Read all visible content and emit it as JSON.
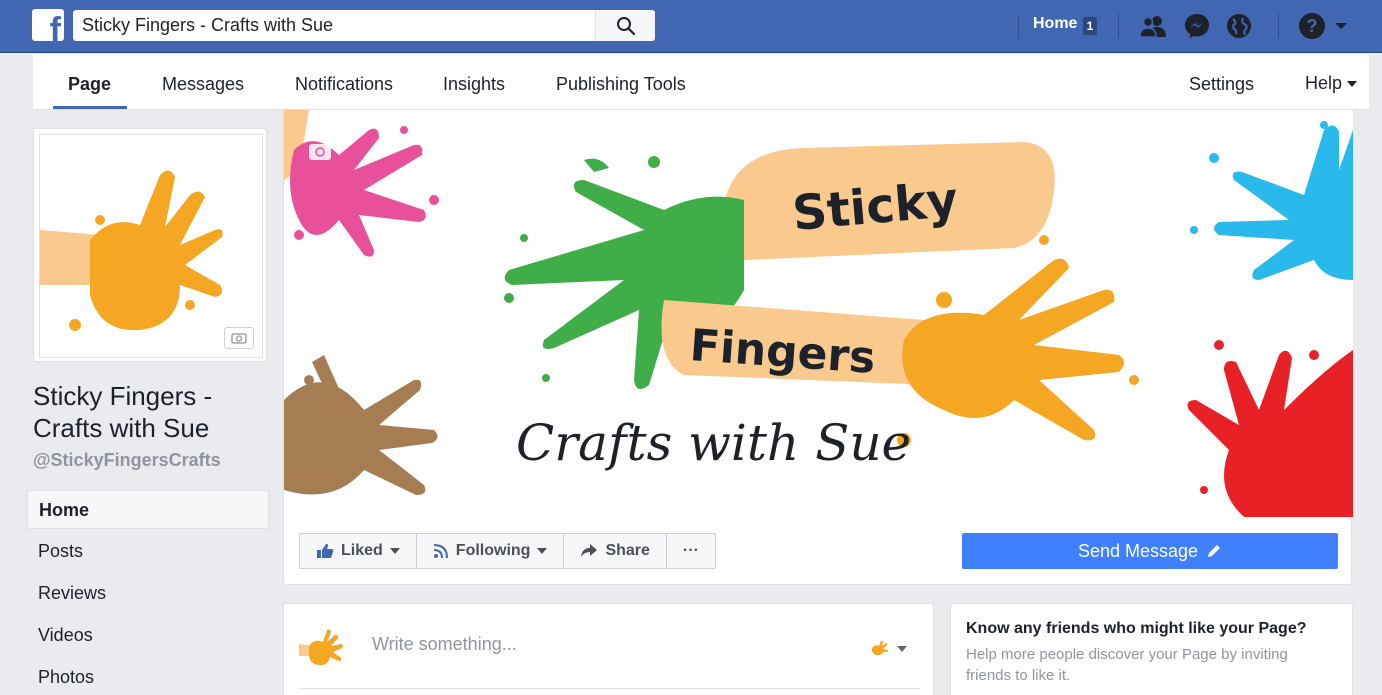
{
  "topbar": {
    "logo": "f",
    "search_value": "Sticky Fingers - Crafts with Sue",
    "home_label": "Home",
    "home_badge": "1",
    "icons": [
      "friends-icon",
      "messenger-icon",
      "globe-icon",
      "help-icon",
      "dropdown-caret-icon"
    ]
  },
  "pagenav": {
    "tabs": [
      {
        "label": "Page",
        "active": true
      },
      {
        "label": "Messages"
      },
      {
        "label": "Notifications"
      },
      {
        "label": "Insights"
      },
      {
        "label": "Publishing Tools"
      }
    ],
    "settings_label": "Settings",
    "help_label": "Help"
  },
  "sidebar": {
    "page_name": "Sticky Fingers - Crafts with Sue",
    "handle": "@StickyFingersCrafts",
    "items": [
      {
        "label": "Home",
        "active": true
      },
      {
        "label": "Posts"
      },
      {
        "label": "Reviews"
      },
      {
        "label": "Videos"
      },
      {
        "label": "Photos"
      }
    ]
  },
  "cover": {
    "word1": "Sticky",
    "word2": "Fingers",
    "subtitle": "Crafts with Sue",
    "colors": {
      "green": "#3fae49",
      "orange": "#f5a623",
      "pink": "#e8519a",
      "blue": "#29b9ec",
      "brown": "#a67c52",
      "red": "#e82127",
      "arm": "#f9c98d"
    }
  },
  "actions": {
    "liked": "Liked",
    "following": "Following",
    "share": "Share",
    "more": "···",
    "send_message": "Send Message"
  },
  "composer": {
    "placeholder": "Write something..."
  },
  "invite": {
    "title": "Know any friends who might like your Page?",
    "text": "Help more people discover your Page by inviting friends to like it."
  },
  "colors": {
    "fb_blue": "#4267b2",
    "button_blue": "#4080ff"
  }
}
